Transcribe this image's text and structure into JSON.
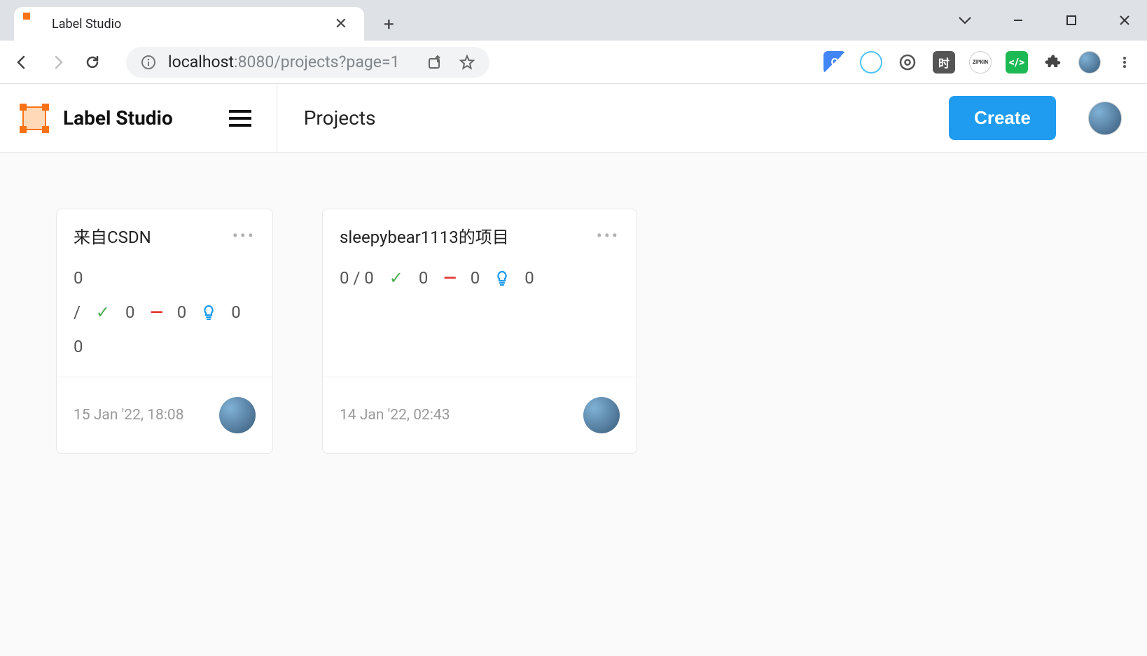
{
  "browser": {
    "tab_title": "Label Studio",
    "url_host": "localhost",
    "url_port_path": ":8080/projects?page=1"
  },
  "header": {
    "brand": "Label Studio",
    "page_title": "Projects",
    "create_label": "Create"
  },
  "projects": [
    {
      "title": "来自CSDN",
      "ratio_total": "0",
      "ratio_sep": "/",
      "check_count": "0",
      "dash_count": "0",
      "bulb_count": "0",
      "extra": "0",
      "date": "15 Jan '22, 18:08"
    },
    {
      "title": "sleepybear1113的项目",
      "ratio": "0 / 0",
      "check_count": "0",
      "dash_count": "0",
      "bulb_count": "0",
      "date": "14 Jan '22, 02:43"
    }
  ]
}
